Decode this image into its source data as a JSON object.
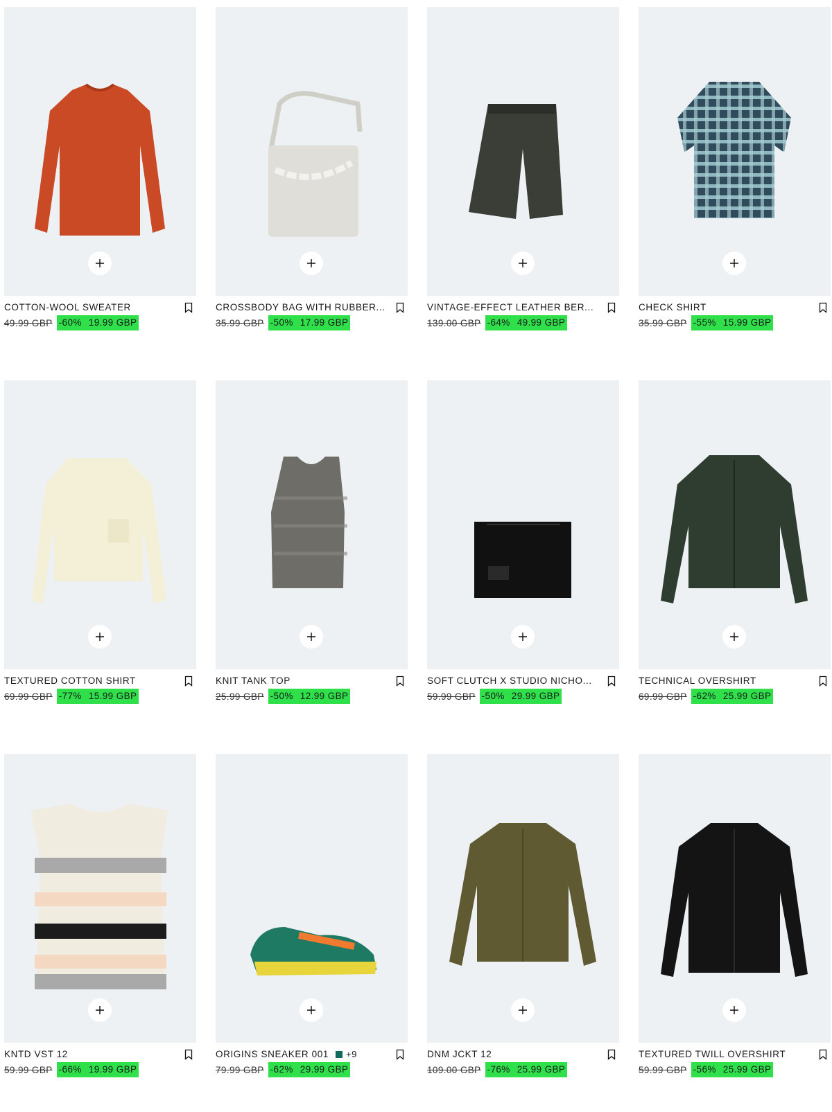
{
  "accent_sale_bg": "#2fe04a",
  "products": [
    {
      "name": "COTTON-WOOL SWEATER",
      "old_price": "49.99 GBP",
      "discount": "-60%",
      "price": "19.99 GBP",
      "icon": "sweater-image"
    },
    {
      "name": "CROSSBODY BAG WITH RUBBER...",
      "old_price": "35.99 GBP",
      "discount": "-50%",
      "price": "17.99 GBP",
      "icon": "bag-image"
    },
    {
      "name": "VINTAGE-EFFECT LEATHER BER...",
      "old_price": "139.00 GBP",
      "discount": "-64%",
      "price": "49.99 GBP",
      "icon": "shorts-image"
    },
    {
      "name": "CHECK SHIRT",
      "old_price": "35.99 GBP",
      "discount": "-55%",
      "price": "15.99 GBP",
      "icon": "shirt-image"
    },
    {
      "name": "TEXTURED COTTON SHIRT",
      "old_price": "69.99 GBP",
      "discount": "-77%",
      "price": "15.99 GBP",
      "icon": "shirt-image"
    },
    {
      "name": "KNIT TANK TOP",
      "old_price": "25.99 GBP",
      "discount": "-50%",
      "price": "12.99 GBP",
      "icon": "tank-image"
    },
    {
      "name": "SOFT CLUTCH X STUDIO NICHO...",
      "old_price": "59.99 GBP",
      "discount": "-50%",
      "price": "29.99 GBP",
      "icon": "clutch-image"
    },
    {
      "name": "TECHNICAL OVERSHIRT",
      "old_price": "69.99 GBP",
      "discount": "-62%",
      "price": "25.99 GBP",
      "icon": "jacket-image"
    },
    {
      "name": "KNTD VST 12",
      "old_price": "59.99 GBP",
      "discount": "-66%",
      "price": "19.99 GBP",
      "icon": "vest-image"
    },
    {
      "name": "ORIGINS SNEAKER 001",
      "old_price": "79.99 GBP",
      "discount": "-62%",
      "price": "29.99 GBP",
      "icon": "sneaker-image",
      "more_colors": "+9",
      "swatch": "#0f6b5e"
    },
    {
      "name": "DNM JCKT 12",
      "old_price": "109.00 GBP",
      "discount": "-76%",
      "price": "25.99 GBP",
      "icon": "jacket-image"
    },
    {
      "name": "TEXTURED TWILL OVERSHIRT",
      "old_price": "59.99 GBP",
      "discount": "-56%",
      "price": "25.99 GBP",
      "icon": "jacket-image"
    }
  ]
}
